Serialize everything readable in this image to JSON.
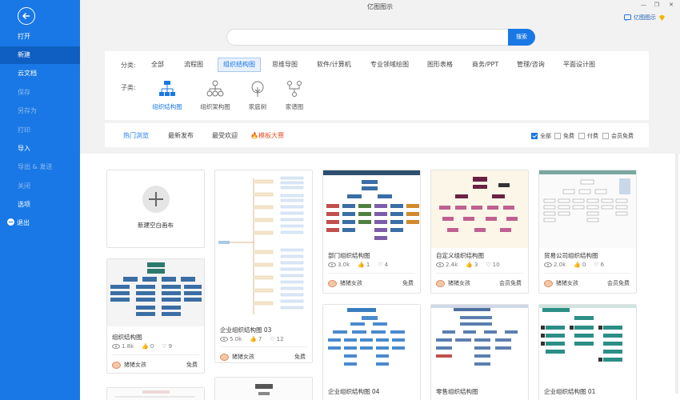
{
  "window": {
    "title": "亿图图示",
    "minimize": "—",
    "restore": "❐",
    "close": "✕",
    "brand": "亿图图示"
  },
  "sidebar": {
    "items": [
      {
        "label": "打开",
        "active": false
      },
      {
        "label": "新建",
        "active": true
      },
      {
        "label": "云文档",
        "active": false
      },
      {
        "label": "保存",
        "dim": true
      },
      {
        "label": "另存为",
        "dim": true
      },
      {
        "label": "打印",
        "dim": true
      },
      {
        "label": "导入",
        "dim": false
      },
      {
        "label": "导出 & 发送",
        "dim": true
      },
      {
        "label": "关闭",
        "dim": true
      },
      {
        "label": "选项",
        "dim": false
      },
      {
        "label": "退出",
        "dim": false
      }
    ]
  },
  "search": {
    "value": "",
    "placeholder": "",
    "button": "搜索"
  },
  "filters": {
    "category_label": "分类:",
    "categories": [
      "全部",
      "流程图",
      "组织结构图",
      "思维导图",
      "软件/计算机",
      "专业领域绘图",
      "图形表格",
      "商务/PPT",
      "管理/咨询",
      "平面设计图"
    ],
    "active_category": "组织结构图",
    "sub_label": "子类:",
    "subcategories": [
      "组织结构图",
      "组织架构图",
      "家庭树",
      "家谱图"
    ]
  },
  "tabs": {
    "items": [
      "热门浏览",
      "最新发布",
      "最受欢迎",
      "模板大赛"
    ],
    "checks": [
      "全部",
      "免费",
      "付费",
      "会员免费"
    ]
  },
  "colors": {
    "accent": "#1978e5",
    "sidebar": "#1978e5",
    "hot": "#e8552e"
  },
  "cards": {
    "new_blank": "新建空白画布",
    "c1": {
      "title": "组织结构图",
      "views": "1.8k",
      "likes": "0",
      "favs": "9",
      "author": "猪猪女孩",
      "price": "免费"
    },
    "c2": {
      "title": "企业组织结构图 03",
      "views": "5.0k",
      "likes": "7",
      "favs": "12",
      "author": "猪猪女孩",
      "price": "免费"
    },
    "c3": {
      "title": "部门组织结构图",
      "views": "3.0k",
      "likes": "1",
      "favs": "4",
      "author": "猪猪女孩",
      "price": "免费"
    },
    "c4": {
      "title": "自定义组织结构图",
      "views": "2.4k",
      "likes": "3",
      "favs": "10",
      "author": "猪猪女孩",
      "price": "会员免费"
    },
    "c5": {
      "title": "贸易公司组织结构图",
      "views": "2.0k",
      "likes": "0",
      "favs": "6",
      "author": "猪猪女孩",
      "price": "会员免费"
    },
    "c6": {
      "title": "企业组织结构图 04"
    },
    "c7": {
      "title": "零售组织结构图"
    },
    "c8": {
      "title": "企业组织结构图 01"
    }
  }
}
